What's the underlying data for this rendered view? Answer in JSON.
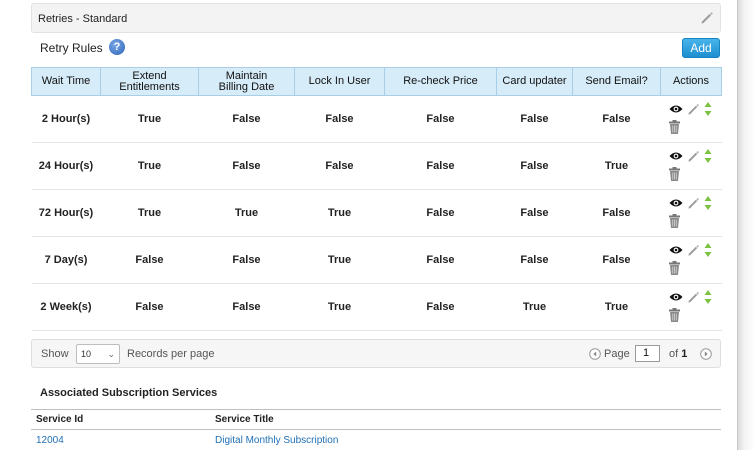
{
  "panel": {
    "title": "Retries - Standard",
    "edit_icon": "pencil-icon"
  },
  "retry_rules": {
    "label": "Retry Rules",
    "help_icon": "question-circle-icon",
    "help_glyph": "?",
    "add_label": "Add",
    "columns": [
      {
        "line1": "Wait Time",
        "line2": ""
      },
      {
        "line1": "Extend",
        "line2": "Entitlements"
      },
      {
        "line1": "Maintain",
        "line2": "Billing Date"
      },
      {
        "line1": "Lock In User",
        "line2": ""
      },
      {
        "line1": "Re-check Price",
        "line2": ""
      },
      {
        "line1": "Card updater",
        "line2": ""
      },
      {
        "line1": "Send Email?",
        "line2": ""
      },
      {
        "line1": "Actions",
        "line2": ""
      }
    ],
    "rows": [
      {
        "wait": "2 Hour(s)",
        "extend": "True",
        "maintain": "False",
        "lock": "False",
        "recheck": "False",
        "card": "False",
        "email": "False"
      },
      {
        "wait": "24 Hour(s)",
        "extend": "True",
        "maintain": "False",
        "lock": "False",
        "recheck": "False",
        "card": "False",
        "email": "True"
      },
      {
        "wait": "72 Hour(s)",
        "extend": "True",
        "maintain": "True",
        "lock": "True",
        "recheck": "False",
        "card": "False",
        "email": "False"
      },
      {
        "wait": "7 Day(s)",
        "extend": "False",
        "maintain": "False",
        "lock": "True",
        "recheck": "False",
        "card": "False",
        "email": "False"
      },
      {
        "wait": "2 Week(s)",
        "extend": "False",
        "maintain": "False",
        "lock": "True",
        "recheck": "False",
        "card": "True",
        "email": "True"
      }
    ],
    "row_actions": [
      "eye-icon",
      "pencil-icon",
      "sort-icon",
      "trash-icon"
    ]
  },
  "pager": {
    "show_label": "Show",
    "per_page": "10",
    "records_label": "Records per page",
    "page_label": "Page",
    "page_value": "1",
    "of_label": "of",
    "total_pages": "1"
  },
  "associated": {
    "title": "Associated Subscription Services",
    "columns": [
      "Service Id",
      "Service Title"
    ],
    "rows": [
      {
        "id": "12004",
        "title": "Digital Monthly Subscription"
      }
    ]
  },
  "colors": {
    "header_bg": "#d6ecf8",
    "add_button": "#2a9ee0",
    "link": "#1f6fb5"
  }
}
